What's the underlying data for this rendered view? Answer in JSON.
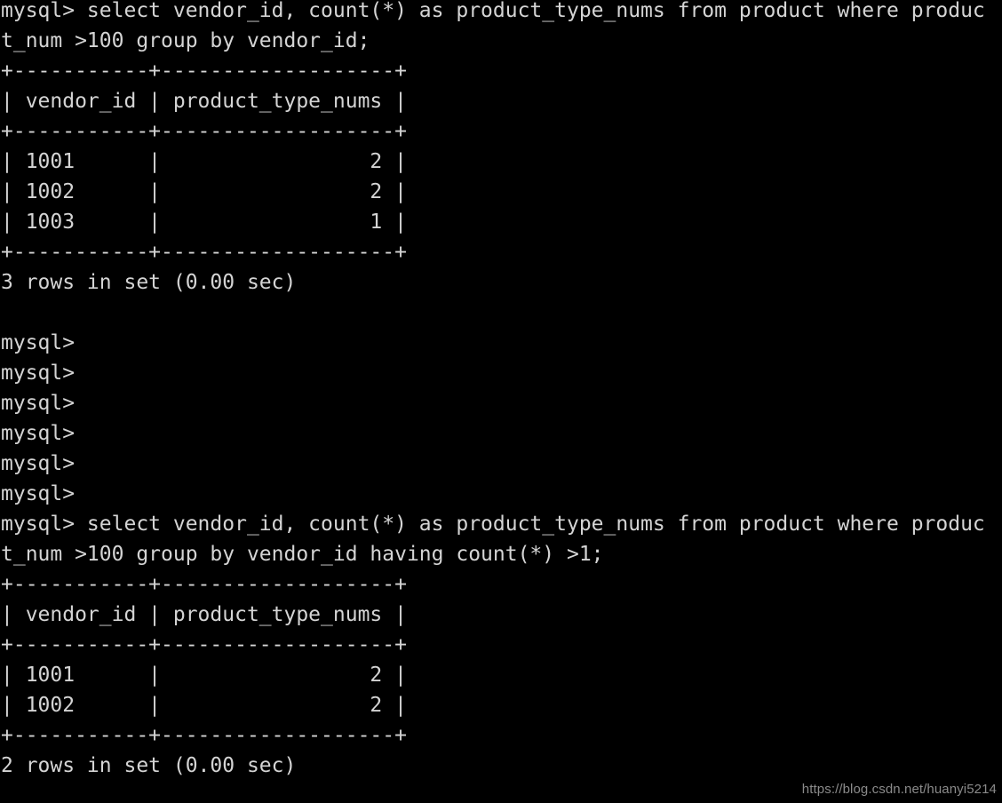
{
  "terminal": {
    "title": "mysql",
    "background_color": "#000000",
    "text_color": "#d4d4d4",
    "prompt": "mysql>",
    "lines": [
      "mysql> select vendor_id, count(*) as product_type_nums from product where produc",
      "t_num >100 group by vendor_id;",
      "+-----------+-------------------+",
      "| vendor_id | product_type_nums |",
      "+-----------+-------------------+",
      "| 1001      |                 2 |",
      "| 1002      |                 2 |",
      "| 1003      |                 1 |",
      "+-----------+-------------------+",
      "3 rows in set (0.00 sec)",
      "",
      "mysql>",
      "mysql>",
      "mysql>",
      "mysql>",
      "mysql>",
      "mysql>",
      "mysql> select vendor_id, count(*) as product_type_nums from product where produc",
      "t_num >100 group by vendor_id having count(*) >1;",
      "+-----------+-------------------+",
      "| vendor_id | product_type_nums |",
      "+-----------+-------------------+",
      "| 1001      |                 2 |",
      "| 1002      |                 2 |",
      "+-----------+-------------------+",
      "2 rows in set (0.00 sec)"
    ],
    "queries": [
      {
        "sql": "select vendor_id, count(*) as product_type_nums from product where product_num >100 group by vendor_id;",
        "result_columns": [
          "vendor_id",
          "product_type_nums"
        ],
        "result_rows": [
          [
            "1001",
            "2"
          ],
          [
            "1002",
            "2"
          ],
          [
            "1003",
            "1"
          ]
        ],
        "status": "3 rows in set (0.00 sec)",
        "row_count": 3,
        "elapsed": "0.00 sec"
      },
      {
        "sql": "select vendor_id, count(*) as product_type_nums from product where product_num >100 group by vendor_id having count(*) >1;",
        "result_columns": [
          "vendor_id",
          "product_type_nums"
        ],
        "result_rows": [
          [
            "1001",
            "2"
          ],
          [
            "1002",
            "2"
          ]
        ],
        "status": "2 rows in set (0.00 sec)",
        "row_count": 2,
        "elapsed": "0.00 sec"
      }
    ]
  },
  "watermark": {
    "text": "https://blog.csdn.net/huanyi5214",
    "color": "#8a8a8a"
  }
}
